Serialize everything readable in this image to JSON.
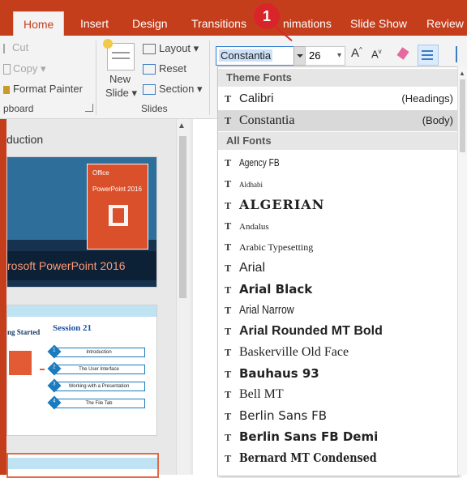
{
  "tabs": [
    {
      "label": "Home"
    },
    {
      "label": "Insert"
    },
    {
      "label": "Design"
    },
    {
      "label": "Transitions"
    },
    {
      "label": "nimations"
    },
    {
      "label": "Slide Show"
    },
    {
      "label": "Review"
    }
  ],
  "callout": "1",
  "clipboard": {
    "cut": "Cut",
    "copy": "Copy",
    "format_painter": "Format Painter",
    "group": "pboard"
  },
  "slides_group": {
    "new_slide": "New",
    "new_slide_2": "Slide",
    "layout": "Layout",
    "reset": "Reset",
    "section": "Section",
    "group": "Slides"
  },
  "font": {
    "current": "Constantia",
    "size": "26"
  },
  "outline": {
    "title": "duction"
  },
  "slide1": {
    "logo": "Office",
    "product": "PowerPoint 2016",
    "caption": "rosoft PowerPoint 2016"
  },
  "slide2": {
    "left_title": "ng Started",
    "session": "Session 21",
    "items": [
      "Introduction",
      "The User Interface",
      "Working with a Presentation",
      "The File Tab"
    ],
    "nums": [
      "1",
      "2",
      "3",
      "4"
    ]
  },
  "dropdown": {
    "theme_header": "Theme Fonts",
    "all_header": "All Fonts",
    "theme_fonts": [
      {
        "name": "Calibri",
        "tag": "(Headings)"
      },
      {
        "name": "Constantia",
        "tag": "(Body)"
      }
    ],
    "all_fonts": [
      {
        "name": "Agency FB"
      },
      {
        "name": "Aldhabi"
      },
      {
        "name": "ALGERIAN"
      },
      {
        "name": "Andalus"
      },
      {
        "name": "Arabic Typesetting"
      },
      {
        "name": "Arial"
      },
      {
        "name": "Arial Black"
      },
      {
        "name": "Arial Narrow"
      },
      {
        "name": "Arial Rounded MT Bold"
      },
      {
        "name": "Baskerville Old Face"
      },
      {
        "name": "Bauhaus 93"
      },
      {
        "name": "Bell MT"
      },
      {
        "name": "Berlin Sans FB"
      },
      {
        "name": "Berlin Sans FB Demi"
      },
      {
        "name": "Bernard MT Condensed"
      }
    ]
  },
  "colors": {
    "accent": "#c43e1c",
    "badge": "#d9252a",
    "selection": "#cce0f7"
  }
}
